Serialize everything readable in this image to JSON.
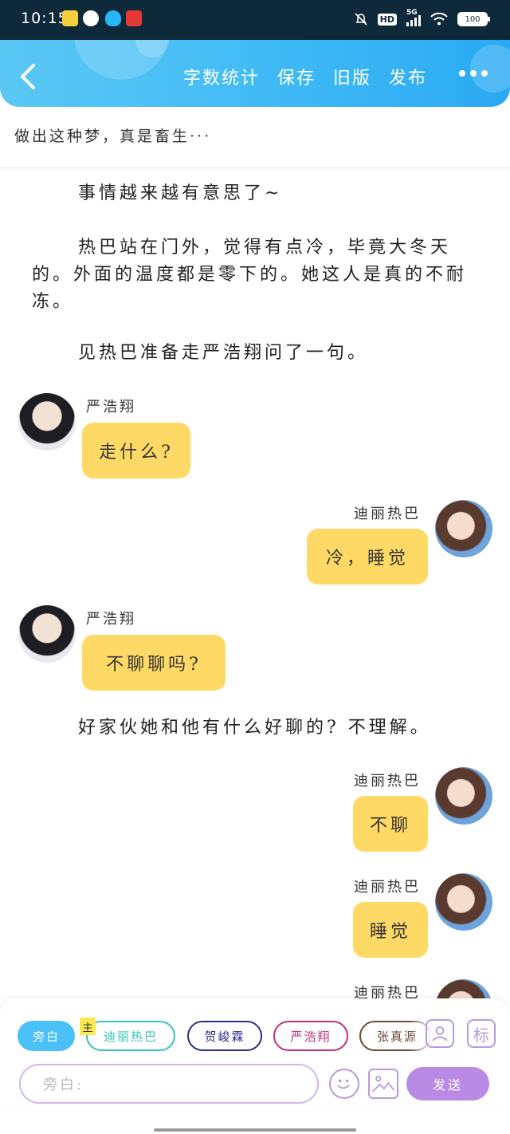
{
  "status_bar": {
    "time": "10:15",
    "network": "5G",
    "hd": "HD",
    "battery": "100"
  },
  "header": {
    "actions": [
      "字数统计",
      "保存",
      "旧版",
      "发布"
    ],
    "accent_color": "#3db8f5"
  },
  "chapter_title": "做出这种梦，真是畜生···",
  "story": [
    {
      "type": "narration",
      "text": "事情越来越有意思了~"
    },
    {
      "type": "narration",
      "text": "热巴站在门外，觉得有点冷，毕竟大冬天的。外面的温度都是零下的。她这人是真的不耐冻。"
    },
    {
      "type": "narration",
      "text": "见热巴准备走严浩翔问了一句。"
    },
    {
      "type": "message",
      "side": "left",
      "speaker": "严浩翔",
      "text": "走什么?"
    },
    {
      "type": "message",
      "side": "right",
      "speaker": "迪丽热巴",
      "text": "冷，睡觉"
    },
    {
      "type": "message",
      "side": "left",
      "speaker": "严浩翔",
      "text": "不聊聊吗?"
    },
    {
      "type": "narration",
      "text": "好家伙她和他有什么好聊的? 不理解。"
    },
    {
      "type": "message",
      "side": "right",
      "speaker": "迪丽热巴",
      "text": "不聊"
    },
    {
      "type": "message",
      "side": "right",
      "speaker": "迪丽热巴",
      "text": "睡觉"
    },
    {
      "type": "message",
      "side": "right",
      "speaker": "迪丽热巴",
      "text": ""
    }
  ],
  "editor": {
    "role_chips": [
      {
        "label": "旁白",
        "active": true
      },
      {
        "label": "迪丽热巴",
        "badge": "主"
      },
      {
        "label": "贺峻霖"
      },
      {
        "label": "严浩翔"
      },
      {
        "label": "张真源"
      }
    ],
    "mark_button_label": "标",
    "input_placeholder": "旁白:",
    "send_label": "发送"
  }
}
